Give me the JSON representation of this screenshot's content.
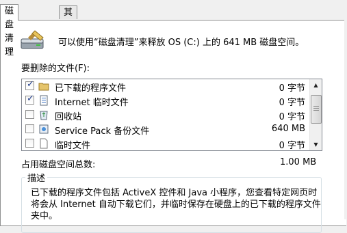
{
  "tabs": [
    {
      "label": "磁盘清理"
    },
    {
      "label": "其他选项"
    }
  ],
  "header": {
    "text": "可以使用“磁盘清理”来释放 OS (C:) 上的 641 MB 磁盘空间。"
  },
  "files_label": "要删除的文件(F):",
  "files": [
    {
      "checked": true,
      "icon": "folder-icon",
      "name": "已下载的程序文件",
      "size": "0 字节"
    },
    {
      "checked": true,
      "icon": "document-icon",
      "name": "Internet 临时文件",
      "size": "0 字节"
    },
    {
      "checked": false,
      "icon": "recycle-bin-icon",
      "name": "回收站",
      "size": "0 字节"
    },
    {
      "checked": false,
      "icon": "service-pack-icon",
      "name": "Service Pack 备份文件",
      "size": "640 MB"
    },
    {
      "checked": false,
      "icon": "file-icon",
      "name": "临时文件",
      "size": "0 字节"
    }
  ],
  "total": {
    "label": "占用磁盘空间总数:",
    "value": "1.00 MB"
  },
  "description": {
    "title": "描述",
    "text": "已下载的程序文件包括 ActiveX 控件和 Java 小程序，您查看特定网页时将会从 Internet 自动下载它们，并临时保存在硬盘上的已下载的程序文件夹中。"
  }
}
